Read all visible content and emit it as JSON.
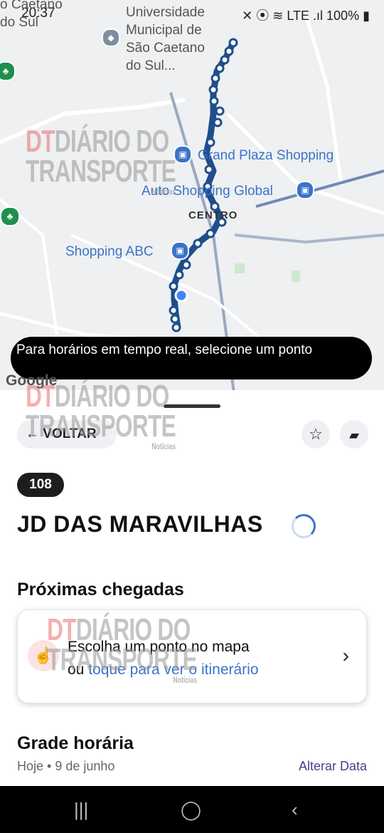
{
  "status_bar": {
    "time": "20:37",
    "battery": "100%",
    "icons_right": "✕ ⦿ ≋ LTE .ıl"
  },
  "map": {
    "places": {
      "top_left": "o Caetano\ndo Sul",
      "university": "Universidade\nMunicipal de\nSão Caetano\ndo Sul...",
      "grand_plaza": "Grand Plaza Shopping",
      "auto_shopping": "Auto Shopping Global",
      "centro": "CENTRO",
      "shopping_abc": "Shopping ABC"
    },
    "route_color": "#1f4e8c",
    "toast": "Para horários em tempo real, selecione um ponto",
    "attribution": "Google"
  },
  "watermark": {
    "line1": "DIÁRIO DO",
    "line2": "TRANSPORTE",
    "brand": "DT",
    "sub": "Notícias"
  },
  "sheet": {
    "back_label": "VOLTAR",
    "line_number": "108",
    "destination": "JD DAS MARAVILHAS",
    "next_arrivals_title": "Próximas chegadas",
    "card": {
      "line1": "Escolha um ponto no mapa",
      "line2_prefix": "ou ",
      "line2_link": "toque para ver o itinerário"
    },
    "schedule_title": "Grade horária",
    "date": "Hoje • 9 de junho",
    "change_date": "Alterar Data"
  },
  "colors": {
    "accent_blue": "#3b73c9",
    "link_purple": "#4a3f8f",
    "route_dark": "#1f4e8c"
  },
  "icons": [
    "back-arrow-icon",
    "star-icon",
    "feedback-icon",
    "touch-icon",
    "chevron-right-icon",
    "shopping-icon",
    "tree-icon",
    "location-dot-icon"
  ]
}
